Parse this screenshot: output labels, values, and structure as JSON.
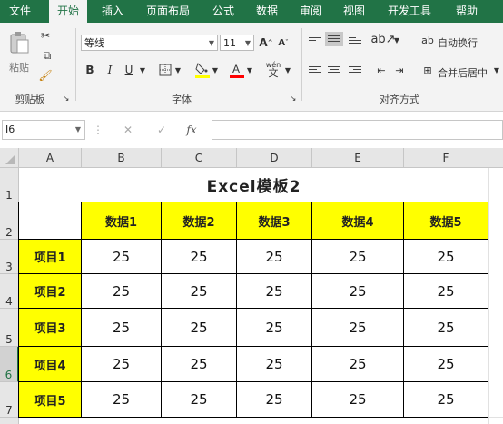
{
  "tabs": [
    "文件",
    "开始",
    "插入",
    "页面布局",
    "公式",
    "数据",
    "审阅",
    "视图",
    "开发工具",
    "帮助"
  ],
  "active_tab": "开始",
  "clipboard": {
    "paste_label": "粘贴",
    "group_label": "剪贴板"
  },
  "font": {
    "name": "等线",
    "size": "11",
    "group_label": "字体",
    "bold": "B",
    "italic": "I",
    "underline": "U",
    "grow": "A",
    "shrink": "A",
    "phonetic": "wén"
  },
  "alignment": {
    "wrap_label": "自动换行",
    "merge_label": "合并后居中",
    "group_label": "对齐方式"
  },
  "formula_bar": {
    "name_box": "I6",
    "fx": "fx",
    "cancel": "✕",
    "confirm": "✓",
    "value": ""
  },
  "columns": [
    "A",
    "B",
    "C",
    "D",
    "E",
    "F"
  ],
  "rows": [
    "1",
    "2",
    "3",
    "4",
    "5",
    "6",
    "7"
  ],
  "selected_row": "6",
  "sheet": {
    "title": "Excel模板2",
    "col_headers": [
      "数据1",
      "数据2",
      "数据3",
      "数据4",
      "数据5"
    ],
    "row_headers": [
      "项目1",
      "项目2",
      "项目3",
      "项目4",
      "项目5"
    ],
    "values": [
      [
        "25",
        "25",
        "25",
        "25",
        "25"
      ],
      [
        "25",
        "25",
        "25",
        "25",
        "25"
      ],
      [
        "25",
        "25",
        "25",
        "25",
        "25"
      ],
      [
        "25",
        "25",
        "25",
        "25",
        "25"
      ],
      [
        "25",
        "25",
        "25",
        "25",
        "25"
      ]
    ]
  },
  "colors": {
    "excel_green": "#217346",
    "highlight": "#ffff00"
  }
}
